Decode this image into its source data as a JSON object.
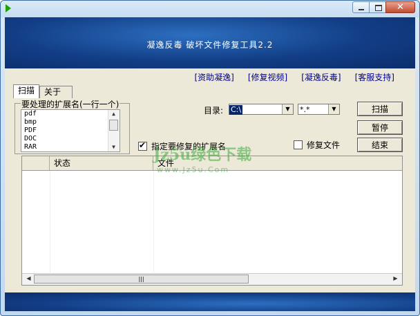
{
  "window": {
    "title": ""
  },
  "banner": {
    "title": "凝逸反毒 破坏文件修复工具2.2"
  },
  "links": [
    "[资助凝逸]",
    "[修复视频]",
    "[凝逸反毒]",
    "[客服支持]"
  ],
  "tabs": [
    "扫描",
    "关于"
  ],
  "extensions": {
    "group_label": "要处理的扩展名(一行一个)",
    "items": [
      "pdf",
      "bmp",
      "PDF",
      "DOC",
      "RAR"
    ]
  },
  "directory": {
    "label": "目录:",
    "value": "C:\\",
    "filter": "*.*"
  },
  "buttons": {
    "scan": "扫描",
    "pause": "暂停",
    "end": "结束"
  },
  "checks": {
    "specify_ext": {
      "label": "指定要修复的扩展名",
      "checked": true
    },
    "repair_files": {
      "label": "修复文件",
      "checked": false
    }
  },
  "table": {
    "columns": [
      "",
      "状态",
      "文件"
    ]
  },
  "watermark": {
    "main": "Jz5u绿色下载",
    "sub": "www.Jz5u.Com"
  }
}
